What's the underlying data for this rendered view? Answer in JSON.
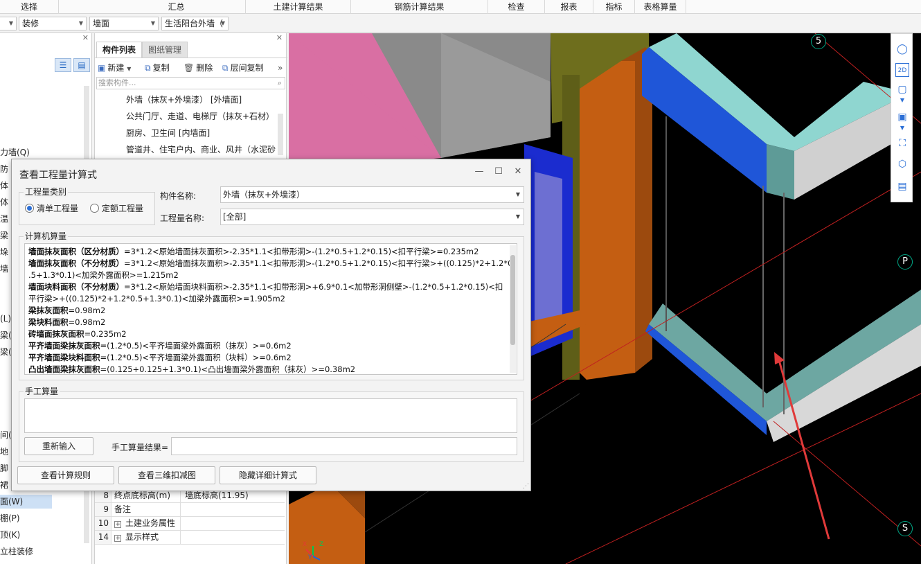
{
  "menu": [
    "选择",
    "汇总",
    "土建计算结果",
    "钢筋计算结果",
    "检查",
    "报表",
    "指标",
    "表格算量"
  ],
  "filters": [
    "",
    "装修",
    "墙面",
    "生活阳台外墙（"
  ],
  "left_nav": {
    "items": [
      "力墙(Q)",
      "防",
      "体",
      "体",
      "温",
      "梁",
      "垛",
      "墙",
      "(L)",
      "梁(",
      "梁(",
      "间(",
      "地",
      "脚",
      "裙",
      "面(W)",
      "棚(P)",
      "顶(K)",
      "立柱装修"
    ],
    "selected": "面(W)"
  },
  "component_panel": {
    "tabs": [
      "构件列表",
      "图纸管理"
    ],
    "toolbar": {
      "new": "新建",
      "copy": "复制",
      "delete": "删除",
      "floor_copy": "层间复制"
    },
    "search_placeholder": "搜索构件...",
    "tree": [
      "外墙（抹灰+外墙漆） [外墙面]",
      "公共门厅、走道、电梯厅（抹灰+石材）",
      "厨房、卫生间 [内墙面]",
      "管道井、住宅户内、商业、风井（水泥砂"
    ],
    "props": [
      {
        "num": "8",
        "name": "终点底标高(m)",
        "value": "墙底标高(11.95)",
        "expand": false
      },
      {
        "num": "9",
        "name": "备注",
        "value": "",
        "expand": false
      },
      {
        "num": "10",
        "name": "土建业务属性",
        "value": "",
        "expand": true
      },
      {
        "num": "14",
        "name": "显示样式",
        "value": "",
        "expand": true
      }
    ]
  },
  "viewport": {
    "axis_labels": [
      "5",
      "P",
      "S"
    ],
    "gizmo": [
      "X",
      "Y",
      "Z"
    ],
    "tools": [
      "orbit-icon",
      "2D",
      "cube-icon",
      "cube-solid-icon",
      "fit-icon",
      "iso-view-icon",
      "list-view-icon"
    ]
  },
  "dialog": {
    "title": "查看工程量计算式",
    "category_group": "工程量类别",
    "radio_bill": "清单工程量",
    "radio_quota": "定额工程量",
    "component_label": "构件名称:",
    "component_value": "外墙（抹灰+外墙漆）",
    "quantity_label": "工程量名称:",
    "quantity_value": "[全部]",
    "computer_group": "计算机算量",
    "calc_lines": [
      {
        "bold": "墙面抹灰面积（区分材质）",
        "text": "=3*1.2<原始墙面抹灰面积>-2.35*1.1<扣带形洞>-(1.2*0.5+1.2*0.15)<扣平行梁>=0.235m2"
      },
      {
        "bold": "墙面抹灰面积（不分材质）",
        "text": "=3*1.2<原始墙面抹灰面积>-2.35*1.1<扣带形洞>-(1.2*0.5+1.2*0.15)<扣平行梁>+((0.125)*2+1.2*0"
      },
      {
        "bold": "",
        "text": ".5+1.3*0.1)<加梁外露面积>=1.215m2"
      },
      {
        "bold": "墙面块料面积（不分材质）",
        "text": "=3*1.2<原始墙面块料面积>-2.35*1.1<扣带形洞>+6.9*0.1<加带形洞侧壁>-(1.2*0.5+1.2*0.15)<扣"
      },
      {
        "bold": "",
        "text": "平行梁>+((0.125)*2+1.2*0.5+1.3*0.1)<加梁外露面积>=1.905m2"
      },
      {
        "bold": "梁抹灰面积",
        "text": "=0.98m2"
      },
      {
        "bold": "梁块料面积",
        "text": "=0.98m2"
      },
      {
        "bold": "砖墙面抹灰面积",
        "text": "=0.235m2"
      },
      {
        "bold": "平齐墙面梁抹灰面积",
        "text": "=(1.2*0.5)<平齐墙面梁外露面积（抹灰）>=0.6m2"
      },
      {
        "bold": "平齐墙面梁块料面积",
        "text": "=(1.2*0.5)<平齐墙面梁外露面积（块料）>=0.6m2"
      },
      {
        "bold": "凸出墙面梁抹灰面积",
        "text": "=(0.125+0.125+1.3*0.1)<凸出墙面梁外露面积（抹灰）>=0.38m2"
      }
    ],
    "manual_group": "手工算量",
    "reenter_button": "重新输入",
    "manual_result_label": "手工算量结果=",
    "btn_rules": "查看计算规则",
    "btn_3d": "查看三维扣减图",
    "btn_hide": "隐藏详细计算式"
  }
}
